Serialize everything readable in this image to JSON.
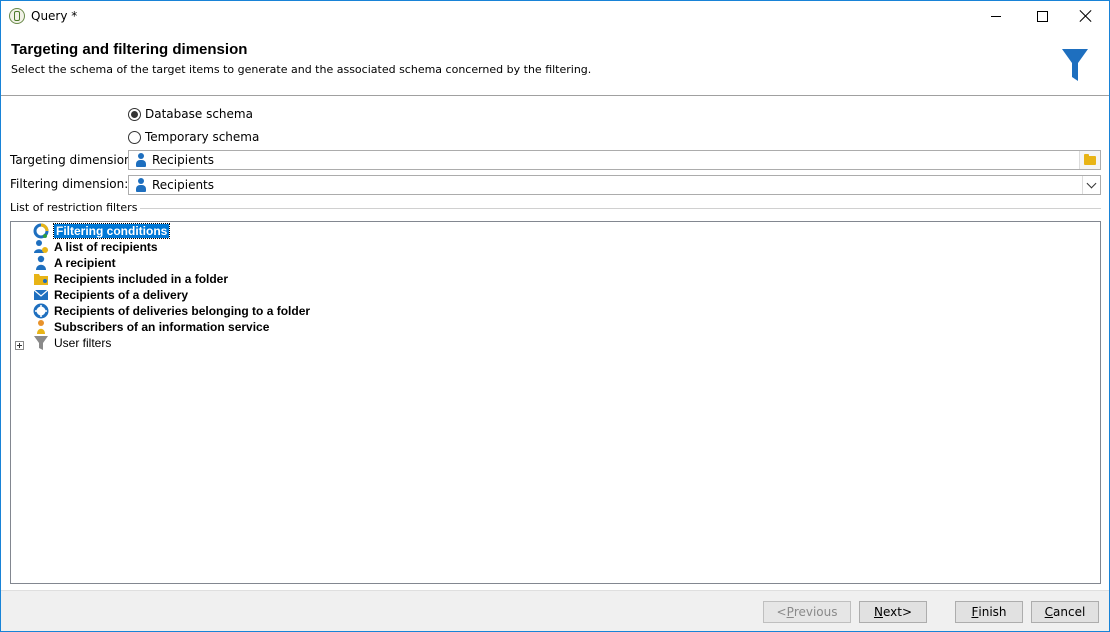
{
  "window": {
    "title": "Query *"
  },
  "header": {
    "title": "Targeting and filtering dimension",
    "subtitle": "Select the schema of the target items to  generate and the associated schema concerned by the filtering."
  },
  "schema_options": [
    {
      "label": "Database schema",
      "checked": true
    },
    {
      "label": "Temporary schema",
      "checked": false
    }
  ],
  "targeting": {
    "label": "Targeting dimension:",
    "value": "Recipients"
  },
  "filtering": {
    "label": "Filtering dimension:",
    "value": "Recipients"
  },
  "filters_section": {
    "label": "List of restriction filters"
  },
  "tree_items": [
    {
      "label": "Filtering conditions",
      "icon": "filtering-conditions-icon",
      "selected": true
    },
    {
      "label": "A list of recipients",
      "icon": "recipients-list-icon"
    },
    {
      "label": "A recipient",
      "icon": "person-icon"
    },
    {
      "label": "Recipients included in a folder",
      "icon": "folder-icon"
    },
    {
      "label": "Recipients of a delivery",
      "icon": "envelope-icon"
    },
    {
      "label": "Recipients of deliveries belonging to a folder",
      "icon": "lifebuoy-icon"
    },
    {
      "label": "Subscribers of an information service",
      "icon": "subscriber-icon"
    },
    {
      "label": "User filters",
      "icon": "funnel-icon",
      "expandable": true
    }
  ],
  "footer": {
    "previous": {
      "first": "P",
      "rest": "revious",
      "prefix": "< "
    },
    "next": {
      "first": "N",
      "rest": "ext",
      "suffix": " >"
    },
    "finish_first": "F",
    "finish_rest": "inish",
    "cancel_first": "C",
    "cancel_rest": "ancel"
  },
  "colors": {
    "accent": "#0078d7",
    "funnel": "#1e6fbf",
    "folder": "#e8b416"
  }
}
